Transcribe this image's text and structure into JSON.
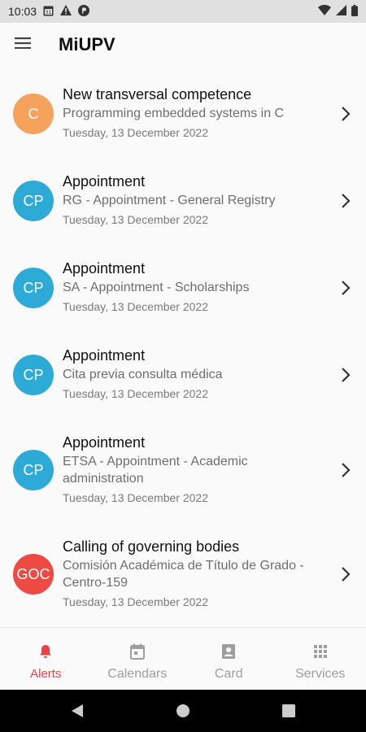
{
  "status_bar": {
    "time": "10:03",
    "icons": [
      "calendar-icon",
      "warning-icon",
      "vpn-icon",
      "wifi-icon",
      "signal-icon",
      "battery-icon"
    ]
  },
  "app_bar": {
    "title": "MiUPV",
    "menu_icon": "hamburger-menu-icon"
  },
  "alerts": [
    {
      "initials": "C",
      "color": "#f5a25d",
      "title": "New transversal competence",
      "subtitle": "Programming embedded systems in C",
      "date": "Tuesday, 13 December 2022"
    },
    {
      "initials": "CP",
      "color": "#2eaad6",
      "title": "Appointment",
      "subtitle": "RG - Appointment - General Registry",
      "date": "Tuesday, 13 December 2022"
    },
    {
      "initials": "CP",
      "color": "#2eaad6",
      "title": "Appointment",
      "subtitle": "SA - Appointment - Scholarships",
      "date": "Tuesday, 13 December 2022"
    },
    {
      "initials": "CP",
      "color": "#2eaad6",
      "title": "Appointment",
      "subtitle": "Cita previa consulta médica",
      "date": "Tuesday, 13 December 2022"
    },
    {
      "initials": "CP",
      "color": "#2eaad6",
      "title": "Appointment",
      "subtitle": "ETSA - Appointment - Academic administration",
      "date": "Tuesday, 13 December 2022"
    },
    {
      "initials": "GOC",
      "color": "#ec4a43",
      "title": "Calling of governing bodies",
      "subtitle": "Comisión Académica de Título de Grado - Centro-159",
      "date": "Tuesday, 13 December 2022"
    }
  ],
  "bottom_nav": {
    "active_color": "#e8434a",
    "items": [
      {
        "label": "Alerts",
        "icon": "bell-icon",
        "active": true
      },
      {
        "label": "Calendars",
        "icon": "calendar-icon",
        "active": false
      },
      {
        "label": "Card",
        "icon": "id-card-icon",
        "active": false
      },
      {
        "label": "Services",
        "icon": "grid-icon",
        "active": false
      }
    ]
  },
  "system_nav": {
    "icons": [
      "back-icon",
      "home-icon",
      "recents-icon"
    ]
  }
}
